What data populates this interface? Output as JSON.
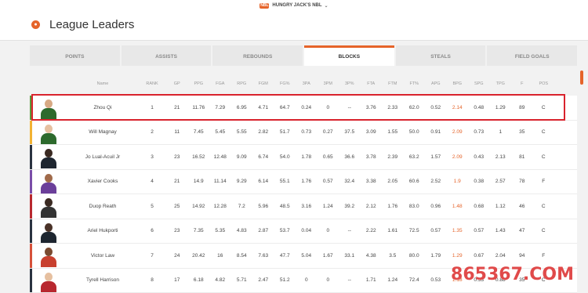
{
  "topbar": {
    "brand": "HUNGRY JACK'S NBL",
    "logo_text": "NBL"
  },
  "header": {
    "title": "League Leaders"
  },
  "tabs": [
    "POINTS",
    "ASSISTS",
    "REBOUNDS",
    "BLOCKS",
    "STEALS",
    "FIELD GOALS"
  ],
  "active_tab": "BLOCKS",
  "columns": [
    "Name",
    "RANK",
    "GP",
    "PPG",
    "FGA",
    "RPG",
    "FGM",
    "FG%",
    "3PA",
    "3PM",
    "3P%",
    "FTA",
    "FTM",
    "FT%",
    "APG",
    "BPG",
    "SPG",
    "TPG",
    "F",
    "POS"
  ],
  "rows": [
    {
      "name": "Zhou Qi",
      "values": [
        "1",
        "21",
        "11.76",
        "7.29",
        "6.95",
        "4.71",
        "64.7",
        "0.24",
        "0",
        "--",
        "3.76",
        "2.33",
        "62.0",
        "0.52",
        "2.14",
        "0.48",
        "1.29",
        "89",
        "C"
      ],
      "accent": "#5a9a3a",
      "skin": "#d7a984",
      "jersey": "#2d6a2d"
    },
    {
      "name": "Will Magnay",
      "values": [
        "2",
        "11",
        "7.45",
        "5.45",
        "5.55",
        "2.82",
        "51.7",
        "0.73",
        "0.27",
        "37.5",
        "3.09",
        "1.55",
        "50.0",
        "0.91",
        "2.09",
        "0.73",
        "1",
        "35",
        "C"
      ],
      "accent": "#f2b233",
      "skin": "#e6c0a0",
      "jersey": "#2d6a2d"
    },
    {
      "name": "Jo Lual-Acuil Jr",
      "values": [
        "3",
        "23",
        "16.52",
        "12.48",
        "9.09",
        "6.74",
        "54.0",
        "1.78",
        "0.65",
        "36.6",
        "3.78",
        "2.39",
        "63.2",
        "1.57",
        "2.09",
        "0.43",
        "2.13",
        "81",
        "C"
      ],
      "accent": "#2a3340",
      "skin": "#3a2a22",
      "jersey": "#1e2630"
    },
    {
      "name": "Xavier Cooks",
      "values": [
        "4",
        "21",
        "14.9",
        "11.14",
        "9.29",
        "6.14",
        "55.1",
        "1.76",
        "0.57",
        "32.4",
        "3.38",
        "2.05",
        "60.6",
        "2.52",
        "1.9",
        "0.38",
        "2.57",
        "78",
        "F"
      ],
      "accent": "#7a4da8",
      "skin": "#a06a4a",
      "jersey": "#6b3f9a"
    },
    {
      "name": "Duop Reath",
      "values": [
        "5",
        "25",
        "14.92",
        "12.28",
        "7.2",
        "5.96",
        "48.5",
        "3.16",
        "1.24",
        "39.2",
        "2.12",
        "1.76",
        "83.0",
        "0.96",
        "1.48",
        "0.68",
        "1.12",
        "46",
        "C"
      ],
      "accent": "#b8282f",
      "skin": "#3a2a22",
      "jersey": "#333333"
    },
    {
      "name": "Ariel Hukporti",
      "values": [
        "6",
        "23",
        "7.35",
        "5.35",
        "4.83",
        "2.87",
        "53.7",
        "0.04",
        "0",
        "--",
        "2.22",
        "1.61",
        "72.5",
        "0.57",
        "1.35",
        "0.57",
        "1.43",
        "47",
        "C"
      ],
      "accent": "#2a3340",
      "skin": "#4a3228",
      "jersey": "#1e2630"
    },
    {
      "name": "Victor Law",
      "values": [
        "7",
        "24",
        "20.42",
        "16",
        "8.54",
        "7.63",
        "47.7",
        "5.04",
        "1.67",
        "33.1",
        "4.38",
        "3.5",
        "80.0",
        "1.79",
        "1.29",
        "0.67",
        "2.04",
        "94",
        "F"
      ],
      "accent": "#d6513a",
      "skin": "#7a4a30",
      "jersey": "#c8402e"
    },
    {
      "name": "Tyrell Harrison",
      "values": [
        "8",
        "17",
        "6.18",
        "4.82",
        "5.71",
        "2.47",
        "51.2",
        "0",
        "0",
        "--",
        "1.71",
        "1.24",
        "72.4",
        "0.53",
        "1.18",
        "0.53",
        "0.88",
        "35",
        "C"
      ],
      "accent": "#2a3340",
      "skin": "#e6c0a0",
      "jersey": "#b8282f"
    }
  ],
  "watermark": "865367.COM",
  "colors": {
    "accent": "#e5642a",
    "highlight": "#d9232d",
    "bpg": "#e5642a"
  }
}
